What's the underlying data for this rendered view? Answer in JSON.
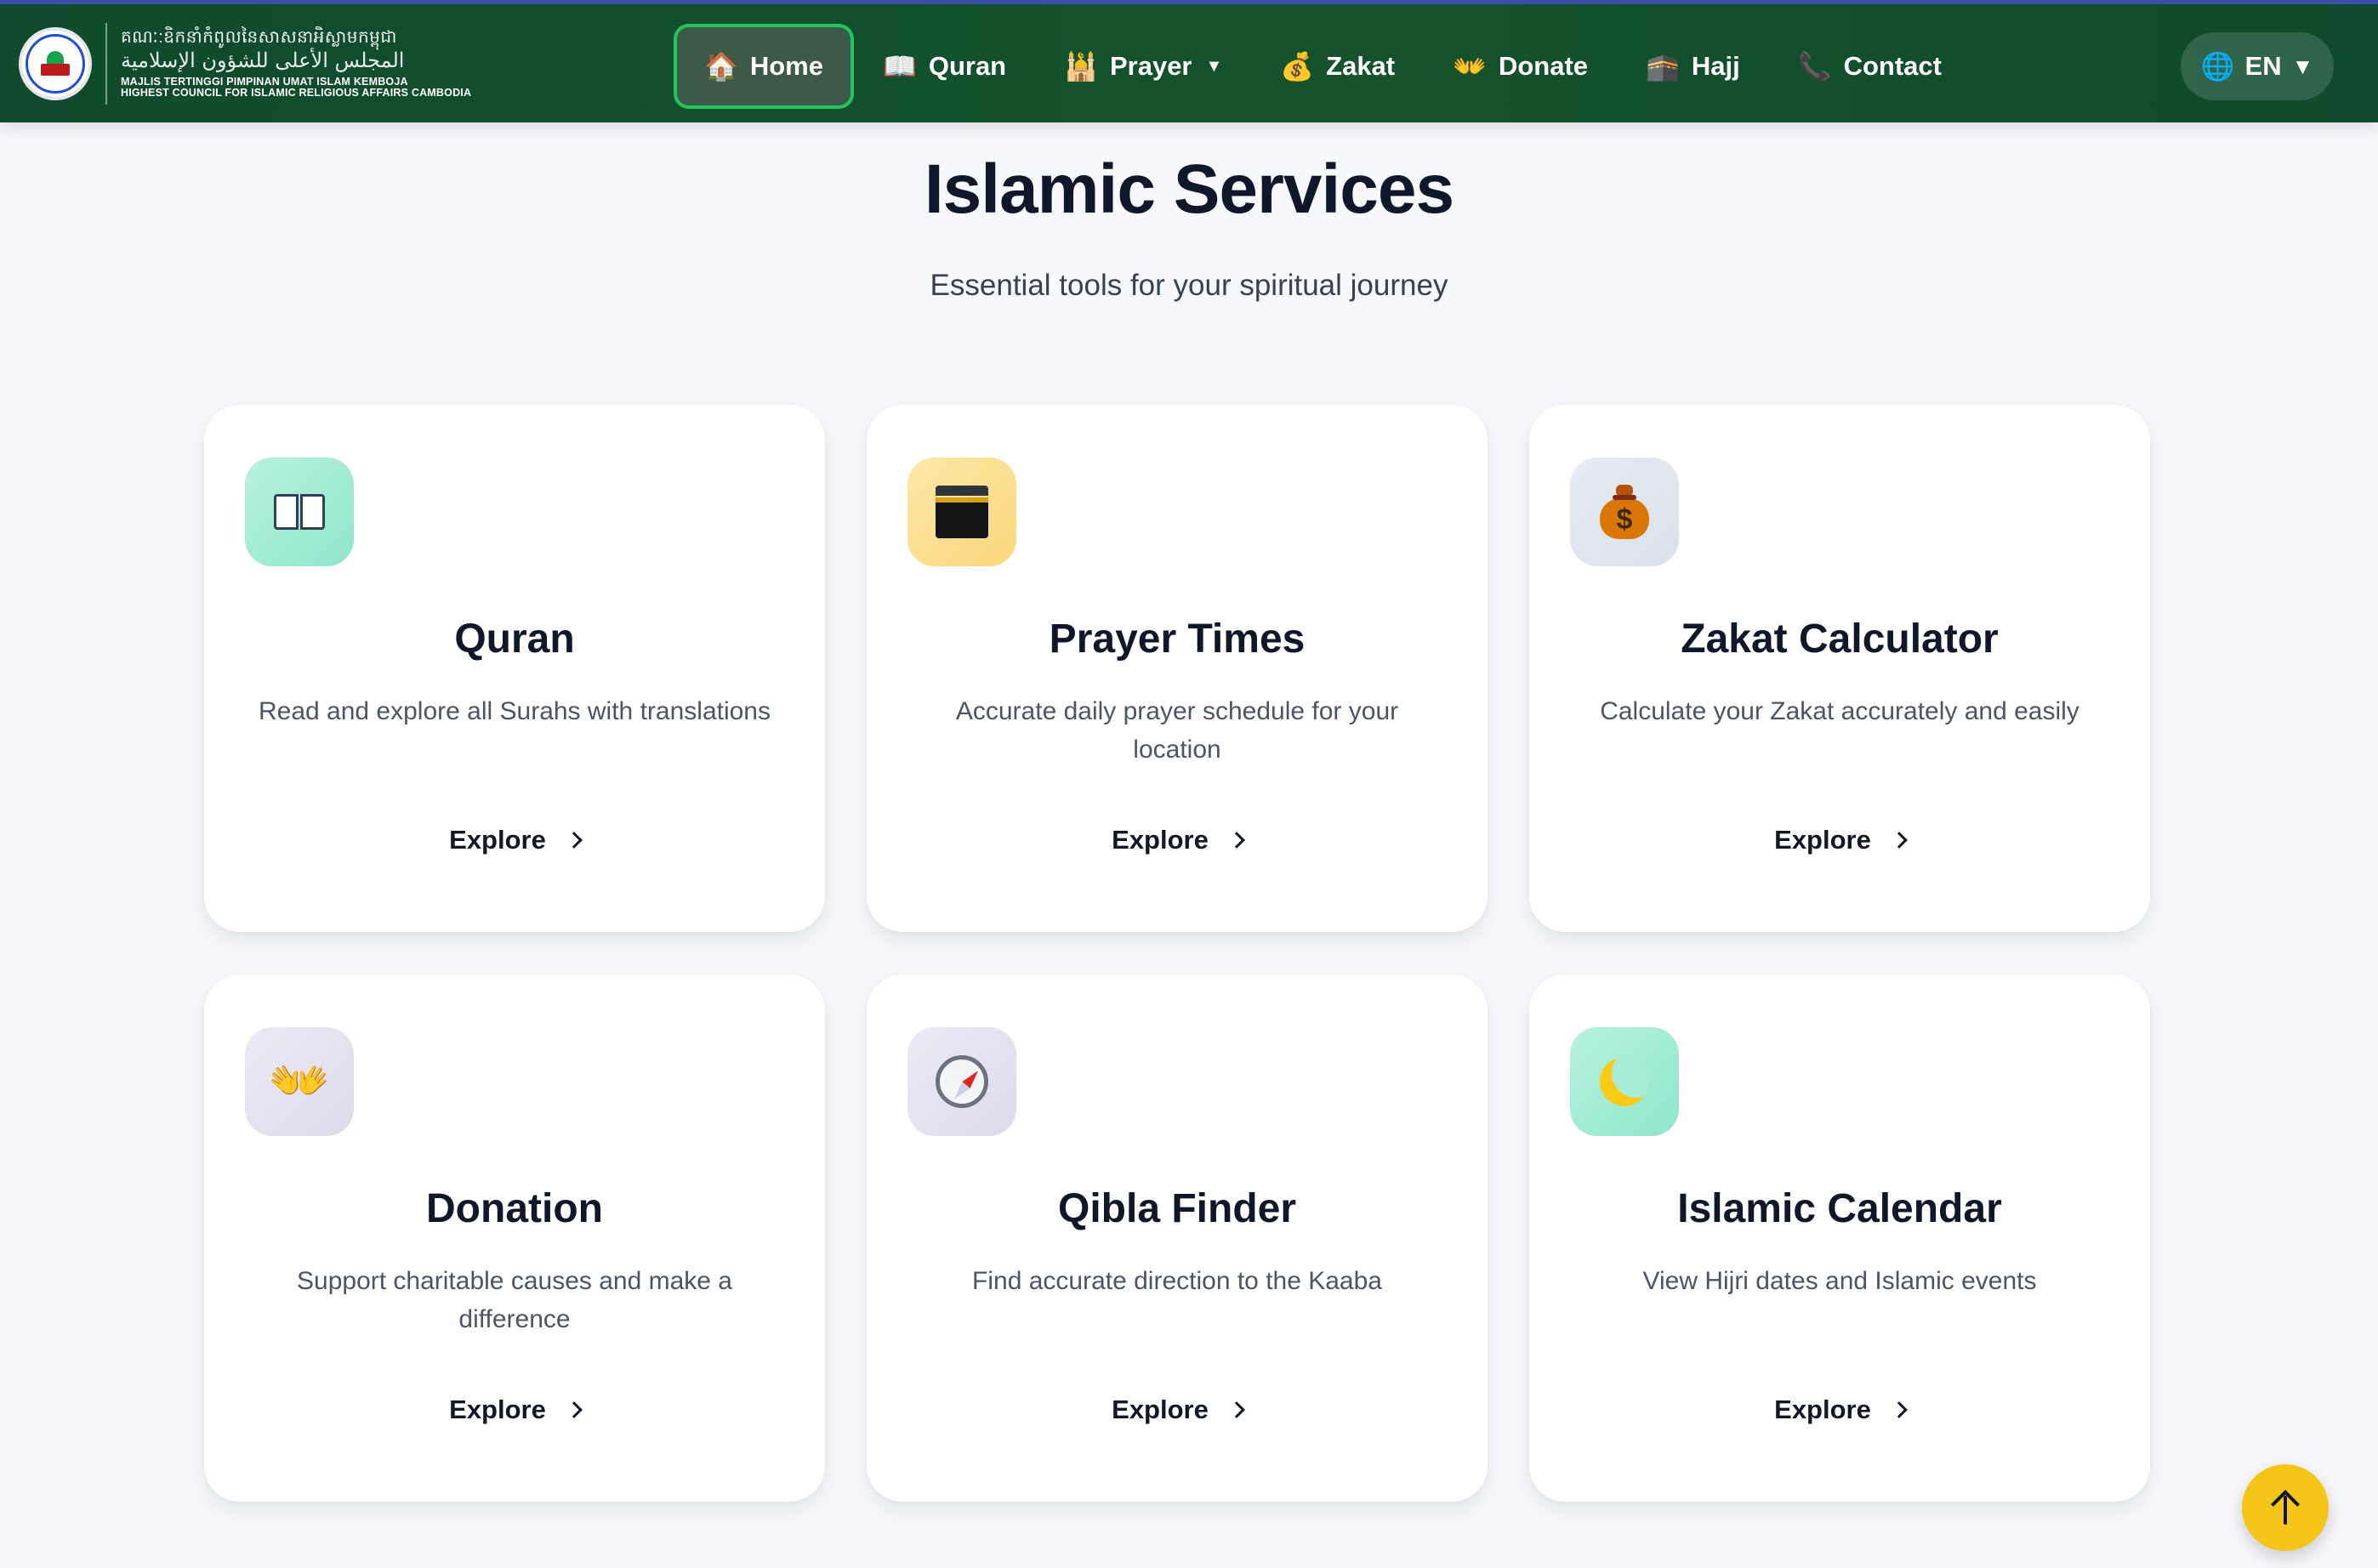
{
  "brand": {
    "kh_line": "គណៈ:ឧិកនាំកំពូលនៃសាសនាអិស្លាមកម្ពុជា",
    "ar_line": "المجلس الأعلى للشؤون الإسلامية",
    "ms_line": "MAJLIS TERTINGGI PIMPINAN UMAT ISLAM KEMBOJA",
    "en_line": "HIGHEST COUNCIL FOR ISLAMIC RELIGIOUS AFFAIRS CAMBODIA"
  },
  "nav": {
    "items": [
      {
        "label": "Home",
        "icon": "🏠",
        "active": true
      },
      {
        "label": "Quran",
        "icon": "📖"
      },
      {
        "label": "Prayer",
        "icon": "🕌",
        "caret": "▼"
      },
      {
        "label": "Zakat",
        "icon": "💰"
      },
      {
        "label": "Donate",
        "icon": "👐"
      },
      {
        "label": "Hajj",
        "icon": "🕋"
      },
      {
        "label": "Contact",
        "icon": "📞"
      }
    ],
    "language": {
      "label": "EN",
      "icon": "🌐",
      "caret": "▼"
    }
  },
  "section": {
    "title": "Islamic Services",
    "subtitle": "Essential tools for your spiritual journey"
  },
  "cards": [
    {
      "title": "Quran",
      "description": "Read and explore all Surahs with translations",
      "cta": "Explore",
      "icon": "book-icon"
    },
    {
      "title": "Prayer Times",
      "description": "Accurate daily prayer schedule for your location",
      "cta": "Explore",
      "icon": "kaaba-icon"
    },
    {
      "title": "Zakat Calculator",
      "description": "Calculate your Zakat accurately and easily",
      "cta": "Explore",
      "icon": "money-bag-icon"
    },
    {
      "title": "Donation",
      "description": "Support charitable causes and make a difference",
      "cta": "Explore",
      "icon": "open-hands-icon"
    },
    {
      "title": "Qibla Finder",
      "description": "Find accurate direction to the Kaaba",
      "cta": "Explore",
      "icon": "compass-icon"
    },
    {
      "title": "Islamic Calendar",
      "description": "View Hijri dates and Islamic events",
      "cta": "Explore",
      "icon": "crescent-moon-icon"
    }
  ],
  "colors": {
    "nav_green": "#14532d",
    "active_border": "#22c55e",
    "accent_yellow": "#f5c518"
  },
  "misc": {
    "bag_symbol": "$",
    "hands_glyph": "👐"
  }
}
